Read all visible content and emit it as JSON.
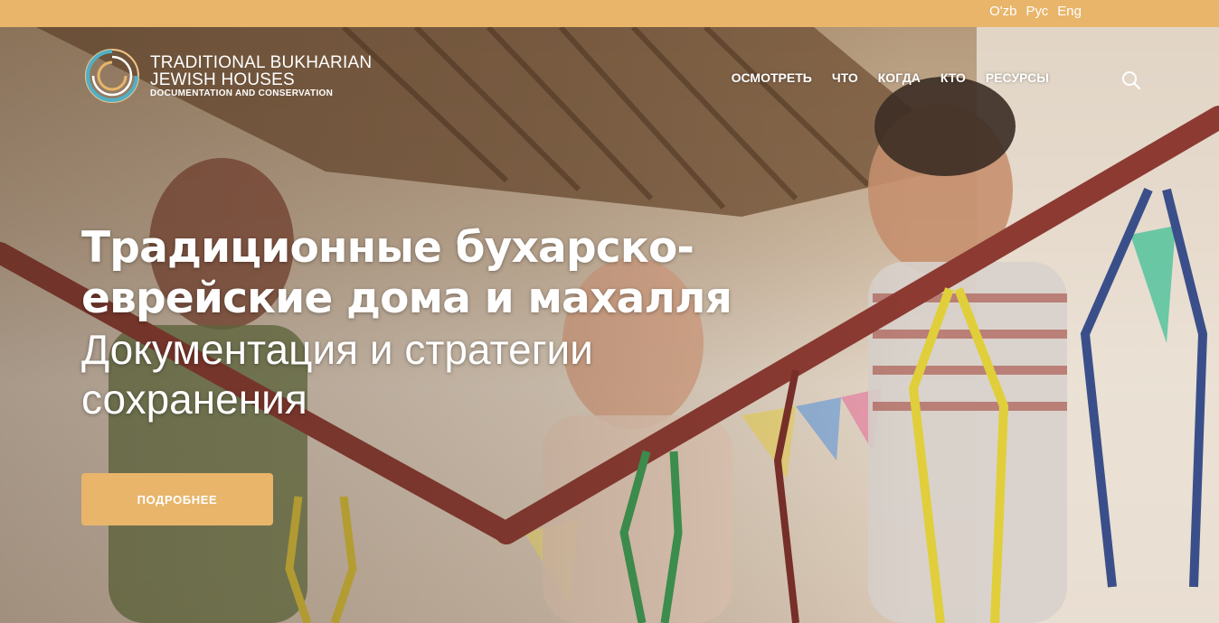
{
  "languages": [
    "O'zb",
    "Рус",
    "Eng"
  ],
  "logo": {
    "line1": "TRADITIONAL BUKHARIAN",
    "line2": "JEWISH HOUSES",
    "line3": "DOCUMENTATION AND CONSERVATION"
  },
  "nav": {
    "items": [
      "ОСМОТРЕТЬ",
      "ЧТО",
      "КОГДА",
      "КТО",
      "РЕСУРСЫ"
    ]
  },
  "search": {
    "icon": "search-icon"
  },
  "hero": {
    "title": "Традиционные бухарско-еврейские дома и махалля",
    "subtitle": "Документация и стратегии сохранения",
    "button_label": "ПОДРОБНЕЕ",
    "image": "children-on-railing-photo"
  },
  "colors": {
    "accent": "#e8b56a",
    "text_on_image": "#ffffff"
  }
}
